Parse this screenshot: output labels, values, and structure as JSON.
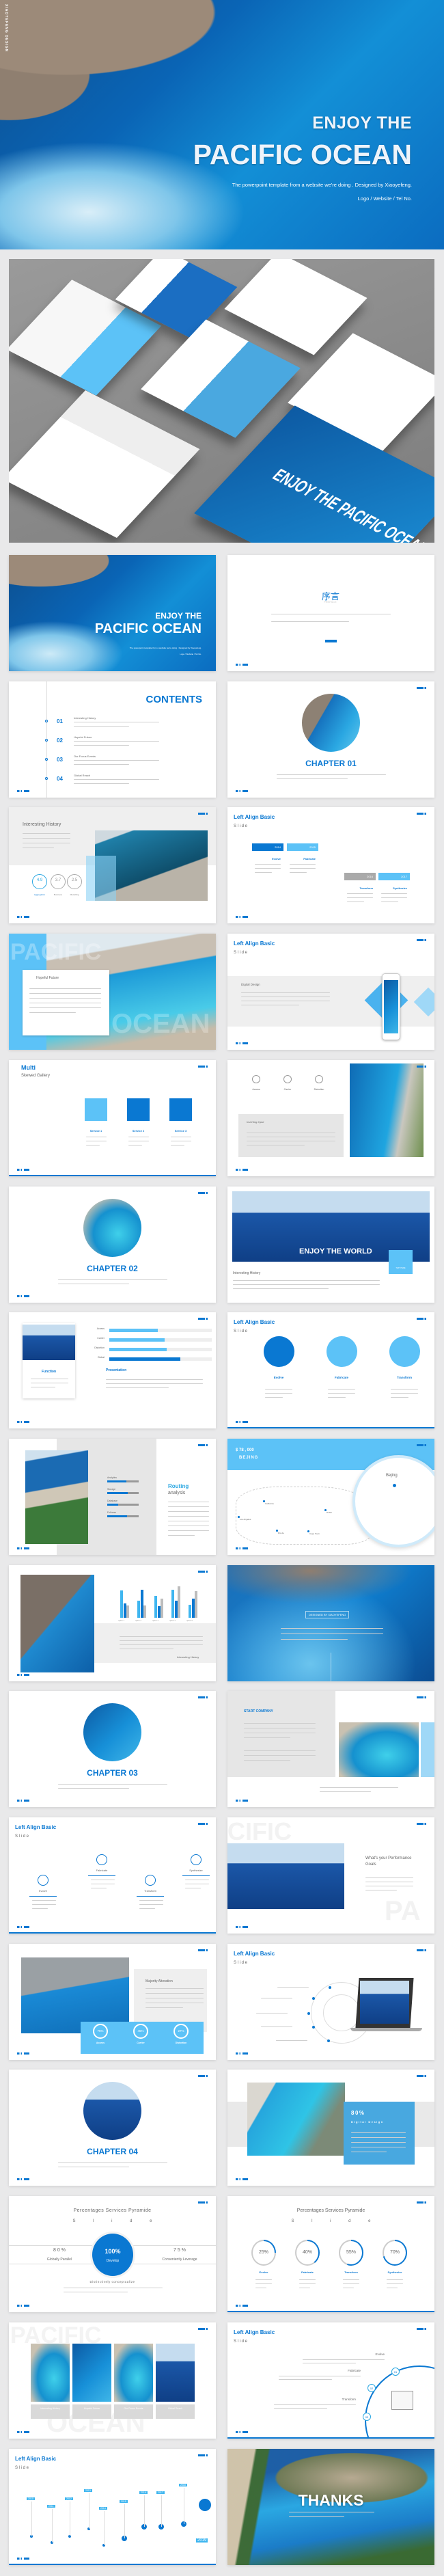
{
  "hero": {
    "brand": "XIAOYEFENG DESIGN",
    "title_line1": "ENJOY THE",
    "title_line2": "PACIFIC OCEAN",
    "subtitle": "The powerpoint template from a website we're doing . Designed by Xiaoyefeng.",
    "contact": "Logo / Website / Tel No."
  },
  "mockup": {
    "caption_slide_title": "ENJOY THE PACIFIC OCEAN",
    "caption_stat": "80%",
    "caption_stat_label": "Digital Design"
  },
  "colors": {
    "accent": "#0a78d2",
    "light_accent": "#5cc2f7",
    "background": "#e9e9ea"
  },
  "slides": [
    {
      "type": "cover",
      "title1": "ENJOY THE",
      "title2": "PACIFIC OCEAN",
      "subtitle": "The powerpoint template from a website we're doing . Designed by Xiaoyefeng.",
      "contact": "Logo / Website / Tel No."
    },
    {
      "type": "preface",
      "title": "序言",
      "subtitle": "PREFACE"
    },
    {
      "type": "contents",
      "title": "CONTENTS",
      "items": [
        {
          "num": "01",
          "label": "Interesting History"
        },
        {
          "num": "02",
          "label": "Hopeful Future"
        },
        {
          "num": "03",
          "label": "Our Focus Events"
        },
        {
          "num": "04",
          "label": "Global Reach"
        }
      ]
    },
    {
      "type": "chapter",
      "title": "CHAPTER 01",
      "photo": "cliff"
    },
    {
      "type": "history",
      "title": "Interesting History",
      "ratings": [
        {
          "value": "4.9",
          "label": "Aggregation"
        },
        {
          "value": "3.7",
          "label": "Business"
        },
        {
          "value": "2.5",
          "label": "Modelling"
        }
      ]
    },
    {
      "type": "timeline4",
      "title": "Left Align Basic",
      "sub": "S l i d e",
      "items": [
        {
          "year": "2014",
          "label": "Evolve"
        },
        {
          "year": "2015",
          "label": "Fabricate"
        },
        {
          "year": "2016",
          "label": "Transform"
        },
        {
          "year": "2017",
          "label": "Synthesize"
        }
      ]
    },
    {
      "type": "hopeful",
      "watermark": "PACIFIC",
      "watermark2": "OCEAN",
      "card_title": "Hopeful Future"
    },
    {
      "type": "phone",
      "title": "Left Align Basic",
      "sub": "S l i d e",
      "panel_title": "Digital Design"
    },
    {
      "type": "services",
      "title": "Multi",
      "subtitle": "Skewed Gallery",
      "items": [
        "Service 1",
        "Service 2",
        "Service 3"
      ]
    },
    {
      "type": "icons3",
      "items": [
        "Access",
        "Carrier",
        "Distortion"
      ],
      "box_title": "Inverting Input"
    },
    {
      "type": "chapter",
      "title": "CHAPTER 02",
      "photo": "lagoon"
    },
    {
      "type": "world",
      "title": "ENJOY THE WORLD",
      "badge": "TEXT HERE",
      "caption": "Interesting History"
    },
    {
      "type": "bars",
      "card_title": "Function",
      "section_title": "Presentation",
      "bars": [
        {
          "label": "Access",
          "value": 0.47
        },
        {
          "label": "Carrier",
          "value": 0.54
        },
        {
          "label": "Distortion",
          "value": 0.56
        },
        {
          "label": "Global",
          "value": 0.69
        }
      ]
    },
    {
      "type": "circles3",
      "title": "Left Align Basic",
      "sub": "S l i d e",
      "items": [
        "Evolve",
        "Fabricate",
        "Transform"
      ]
    },
    {
      "type": "routing",
      "title1": "Routing",
      "title2": "analysis",
      "bars": [
        {
          "label": "Analytics",
          "value": 0.6
        },
        {
          "label": "Storage",
          "value": 0.65
        },
        {
          "label": "Database",
          "value": 0.35
        },
        {
          "label": "Fullness",
          "value": 0.62
        }
      ]
    },
    {
      "type": "map",
      "amount": "$ 78 , 000",
      "city": "BEJING",
      "labels": [
        "Bejing",
        "California",
        "Los Angeles",
        "Dubai",
        "Rio de",
        "Cape Town"
      ]
    },
    {
      "type": "chart",
      "caption": "Interesting History",
      "categories": [
        "option 1",
        "option 2",
        "option 3",
        "option 4",
        "option 5"
      ],
      "series": [
        [
          5.2,
          3.3,
          4.2,
          5.4,
          2.5
        ],
        [
          2.8,
          5.3,
          2.2,
          3.2,
          3.7
        ],
        [
          2.3,
          2.3,
          3.6,
          6.0,
          5.1
        ]
      ],
      "ylim": [
        0,
        6
      ]
    },
    {
      "type": "blur",
      "badge": "DESIGNED BY XIAOYEFENG"
    },
    {
      "type": "chapter",
      "title": "CHAPTER 03",
      "photo": "ocean"
    },
    {
      "type": "company",
      "title": "START COMPANY"
    },
    {
      "type": "zigzag",
      "title": "Left Align Basic",
      "sub": "S l i d e",
      "items": [
        "Evolve",
        "Fabricate",
        "Transform",
        "Synthesize"
      ]
    },
    {
      "type": "goals",
      "watermark": "CIFIC",
      "watermark2": "PA",
      "title": "What's your Performance Goals"
    },
    {
      "type": "majority",
      "title": "Majority Alteration",
      "stats": [
        {
          "value": "75%",
          "label": "Access"
        },
        {
          "value": "45%",
          "label": "Carrier"
        },
        {
          "value": "27%",
          "label": "Distortion"
        }
      ]
    },
    {
      "type": "laptop",
      "title": "Left Align Basic",
      "sub": "S l i d e"
    },
    {
      "type": "chapter",
      "title": "CHAPTER 04",
      "photo": "sky"
    },
    {
      "type": "digital",
      "value": "80%",
      "label": "Digital Design"
    },
    {
      "type": "pyramid",
      "title": "Percentages Services Pyramide",
      "sub": "S l i d e",
      "left_value": "8 0 %",
      "left_label": "Globally Parallel",
      "center_value": "100%",
      "center_label": "Develop",
      "right_value": "7 5 %",
      "right_label": "Conveniently Leverage",
      "caption": "Distinctively conceptualize"
    },
    {
      "type": "rings",
      "title": "Percentages Services Pyramide",
      "sub": "S l i d e",
      "items": [
        {
          "value": 25,
          "text": "25%",
          "label": "Evolve"
        },
        {
          "value": 40,
          "text": "40%",
          "label": "Fabricate"
        },
        {
          "value": 55,
          "text": "55%",
          "label": "Transform"
        },
        {
          "value": 70,
          "text": "70%",
          "label": "Synthesize"
        }
      ]
    },
    {
      "type": "gallery",
      "watermark": "PACIFIC",
      "watermark2": "OCEAN",
      "items": [
        "Interesting History",
        "Hopeful Future",
        "Our Focus Events",
        "Global Reach"
      ]
    },
    {
      "type": "arc",
      "title": "Left Align Basic",
      "sub": "S l i d e",
      "items": [
        {
          "num": "01",
          "label": "Evolve"
        },
        {
          "num": "02",
          "label": "Fabricate"
        },
        {
          "num": "03",
          "label": "Transform"
        }
      ]
    },
    {
      "type": "years",
      "title": "Left Align Basic",
      "sub": "S l i d e",
      "years": [
        "2010",
        "2011",
        "2012",
        "2013",
        "2014",
        "2015",
        "2016",
        "2017",
        "2018",
        "2019"
      ]
    },
    {
      "type": "thanks",
      "title": "THANKS"
    }
  ]
}
